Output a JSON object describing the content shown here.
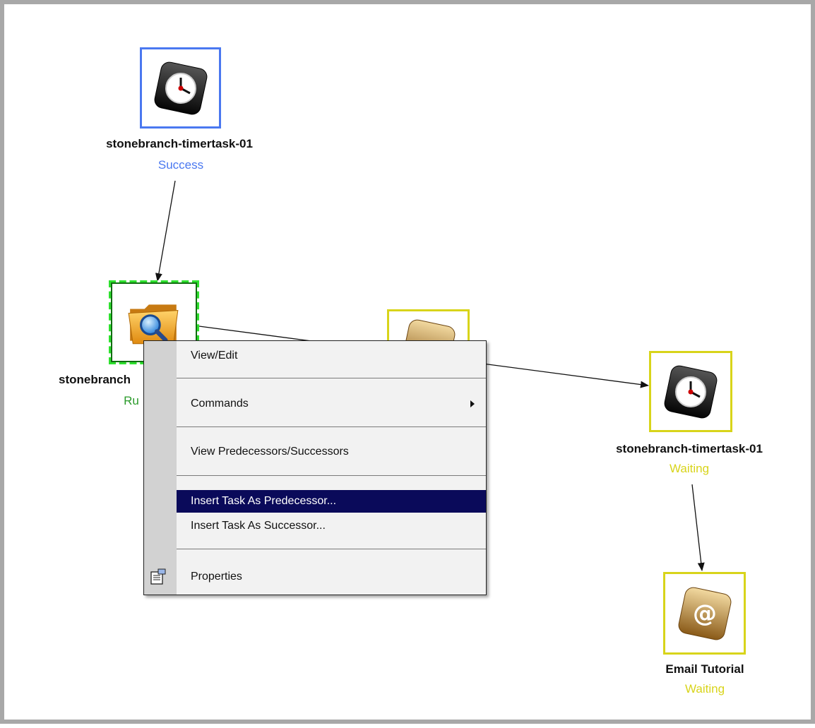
{
  "nodes": [
    {
      "id": "timer-top",
      "name": "stonebranch-timertask-01",
      "status": "Success",
      "kind": "timer",
      "state": "success"
    },
    {
      "id": "folder",
      "name": "stonebranch",
      "status": "Ru",
      "kind": "folder",
      "state": "running"
    },
    {
      "id": "middle",
      "name": "",
      "status": "",
      "kind": "email",
      "state": "waiting"
    },
    {
      "id": "timer-right",
      "name": "stonebranch-timertask-01",
      "status": "Waiting",
      "kind": "timer",
      "state": "waiting"
    },
    {
      "id": "email",
      "name": "Email Tutorial",
      "status": "Waiting",
      "kind": "email",
      "state": "waiting"
    }
  ],
  "menu": {
    "view_edit": "View/Edit",
    "commands": "Commands",
    "view_pred_succ": "View Predecessors/Successors",
    "insert_pred": "Insert Task As Predecessor...",
    "insert_succ": "Insert Task As Successor...",
    "properties": "Properties"
  },
  "colors": {
    "success": "#4a78f0",
    "waiting": "#d8d41a",
    "running": "#2ee02e",
    "menu_highlight": "#0a0a5a"
  },
  "icons": [
    "timer-task-icon",
    "file-monitor-icon",
    "email-task-icon",
    "properties-icon",
    "submenu-arrow-icon"
  ]
}
